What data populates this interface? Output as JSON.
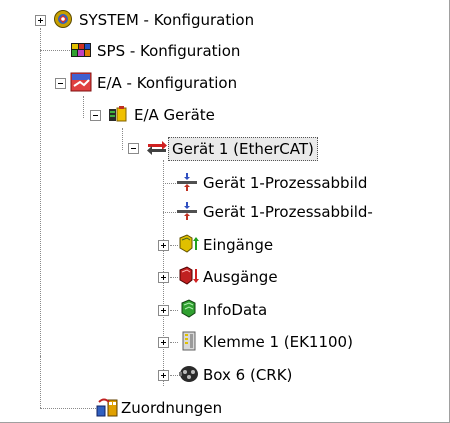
{
  "tree": {
    "system": "SYSTEM - Konfiguration",
    "sps": "SPS - Konfiguration",
    "ea": "E/A - Konfiguration",
    "ea_geraete": "E/A Geräte",
    "geraet1": "Gerät 1 (EtherCAT)",
    "prozess1": "Gerät 1-Prozessabbild",
    "prozess2": "Gerät 1-Prozessabbild-",
    "eingaenge": "Eingänge",
    "ausgaenge": "Ausgänge",
    "infodata": "InfoData",
    "klemme1": "Klemme 1 (EK1100)",
    "box6": "Box 6 (CRK)",
    "zuordnungen": "Zuordnungen"
  }
}
